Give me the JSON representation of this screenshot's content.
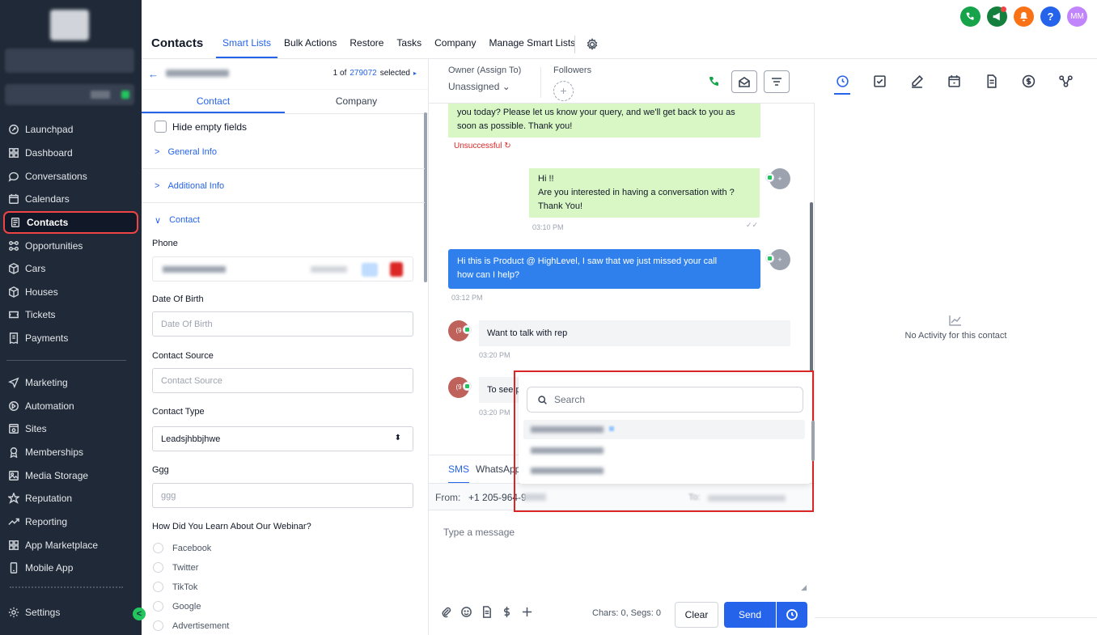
{
  "sidebar": {
    "items": [
      {
        "label": "Launchpad",
        "icon": "rocket-icon"
      },
      {
        "label": "Dashboard",
        "icon": "grid-icon"
      },
      {
        "label": "Conversations",
        "icon": "chat-icon"
      },
      {
        "label": "Calendars",
        "icon": "calendar-icon"
      },
      {
        "label": "Contacts",
        "icon": "contacts-icon"
      },
      {
        "label": "Opportunities",
        "icon": "opportunities-icon"
      },
      {
        "label": "Cars",
        "icon": "cube-icon"
      },
      {
        "label": "Houses",
        "icon": "cube-icon"
      },
      {
        "label": "Tickets",
        "icon": "ticket-icon"
      },
      {
        "label": "Payments",
        "icon": "receipt-icon"
      },
      {
        "label": "Marketing",
        "icon": "send-icon"
      },
      {
        "label": "Automation",
        "icon": "automation-icon"
      },
      {
        "label": "Sites",
        "icon": "sites-icon"
      },
      {
        "label": "Memberships",
        "icon": "badge-icon"
      },
      {
        "label": "Media Storage",
        "icon": "image-icon"
      },
      {
        "label": "Reputation",
        "icon": "star-icon"
      },
      {
        "label": "Reporting",
        "icon": "trend-icon"
      },
      {
        "label": "App Marketplace",
        "icon": "grid-icon"
      },
      {
        "label": "Mobile App",
        "icon": "phone-icon"
      },
      {
        "label": "Settings",
        "icon": "gear-icon"
      }
    ],
    "active": "Contacts",
    "collapse_glyph": "<"
  },
  "topbar": {
    "avatar_initials": "MM",
    "help_glyph": "?"
  },
  "nav": {
    "title": "Contacts",
    "tabs": [
      "Smart Lists",
      "Bulk Actions",
      "Restore",
      "Tasks",
      "Company",
      "Manage Smart Lists"
    ],
    "active_tab": "Smart Lists"
  },
  "contact_panel": {
    "back_glyph": "←",
    "count_prefix": "1 of",
    "count_total": "279072",
    "count_suffix": "selected",
    "next_glyph": "▸",
    "tabs": [
      "Contact",
      "Company"
    ],
    "hide_empty_label": "Hide empty fields",
    "sections": {
      "general_info": "General Info",
      "additional_info": "Additional Info",
      "contact": "Contact"
    },
    "fields": {
      "phone_label": "Phone",
      "dob_label": "Date Of Birth",
      "dob_placeholder": "Date Of Birth",
      "source_label": "Contact Source",
      "source_placeholder": "Contact Source",
      "type_label": "Contact Type",
      "type_value": "Leadsjhbbjhwe",
      "ggg_label": "Ggg",
      "ggg_placeholder": "ggg",
      "webinar_label": "How Did You Learn About Our Webinar?",
      "webinar_options": [
        "Facebook",
        "Twitter",
        "TikTok",
        "Google",
        "Advertisement"
      ]
    }
  },
  "conversation": {
    "owner_label": "Owner (Assign To)",
    "owner_value": "Unassigned",
    "followers_label": "Followers",
    "add_glyph": "+",
    "messages": [
      {
        "text_1": "you today? Please let us know your query, and we'll get back to you as",
        "text_2": "soon as possible. Thank you!",
        "status": "Unsuccessful"
      },
      {
        "line_1": "Hi !!",
        "line_2": "Are you interested in having a conversation with ?",
        "line_3": "Thank You!",
        "time": "03:10 PM"
      },
      {
        "line_1": "Hi this is Product @ HighLevel, I saw that we just missed your call",
        "line_2": "how can I help?",
        "time": "03:12 PM"
      },
      {
        "text": "Want to talk with rep",
        "time": "03:20 PM",
        "avatar": "(9"
      },
      {
        "text": "To see p",
        "time": "03:20 PM",
        "avatar": "(9"
      }
    ],
    "composer": {
      "tabs": [
        "SMS",
        "WhatsApp"
      ],
      "from_label": "From:",
      "from_value": "+1 205-964-9",
      "to_label": "To:",
      "placeholder": "Type a message",
      "chars": "Chars: 0, Segs: 0",
      "clear_label": "Clear",
      "send_label": "Send"
    },
    "dropdown": {
      "search_placeholder": "Search"
    }
  },
  "activity": {
    "empty_text": "No Activity for this contact"
  }
}
